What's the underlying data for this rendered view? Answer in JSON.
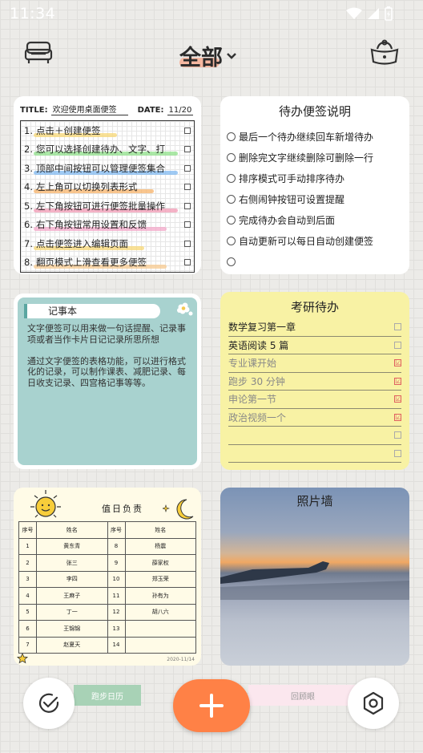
{
  "status_bar": {
    "time": "11:34"
  },
  "header": {
    "title": "全部",
    "left_icon": "sofa-icon",
    "right_icon": "chest-icon",
    "title_icon": "chevron-down-icon"
  },
  "card_welcome": {
    "title_label": "TITLE:",
    "title_value": "欢迎使用桌面便签",
    "date_label": "DATE:",
    "date_value": "11/20",
    "items": [
      {
        "num": "1.",
        "text": "点击＋创建便签",
        "highlight": "#f7d774"
      },
      {
        "num": "2.",
        "text": "您可以选择创建待办、文字、打",
        "highlight": "#8fe08a"
      },
      {
        "num": "3.",
        "text": "顶部中间按钮可以管理便签集合",
        "highlight": "#7fb8f0"
      },
      {
        "num": "4.",
        "text": "左上角可以切换列表形式",
        "highlight": "#f7b36a"
      },
      {
        "num": "5.",
        "text": "左下角按钮可进行便签批量操作",
        "highlight": "#f29ab4"
      },
      {
        "num": "6.",
        "text": "右下角按钮常用设置和反馈",
        "highlight": "#f3a7c8"
      },
      {
        "num": "7.",
        "text": "点击便签进入编辑页面",
        "highlight": "#f7d774"
      },
      {
        "num": "8.",
        "text": "翻页模式上滑查看更多便签",
        "highlight": "#f7c98f"
      }
    ]
  },
  "card_todo_help": {
    "title": "待办便签说明",
    "items": [
      "最后一个待办继续回车新增待办",
      "删除完文字继续删除可删除一行",
      "排序模式可手动排序待办",
      "右侧闹钟按钮可设置提醒",
      "完成待办会自动到后面",
      "自动更新可以每日自动创建便签",
      ""
    ]
  },
  "card_notebook": {
    "tab_label": "记事本",
    "text": "文字便签可以用来做一句话提醒、记录事项或者当作卡片日记记录所思所想\n\n通过文字便签的表格功能，可以进行格式化的记录，可以制作课表、减肥记录、每日收支记录、四宫格记事等等。"
  },
  "card_exam": {
    "title": "考研待办",
    "items": [
      {
        "text": "数学复习第一章",
        "done": false
      },
      {
        "text": "英语阅读 5 篇",
        "done": false
      },
      {
        "text": "专业课开始",
        "done": true
      },
      {
        "text": "跑步 30 分钟",
        "done": true
      },
      {
        "text": "申论第一节",
        "done": true
      },
      {
        "text": "政治视频一个",
        "done": true
      },
      {
        "text": "",
        "done": false
      },
      {
        "text": "",
        "done": false
      }
    ],
    "check_mark": "☑"
  },
  "card_duty": {
    "title": "值日负责",
    "headers": [
      "序号",
      "姓名",
      "序号",
      "姓名"
    ],
    "rows": [
      [
        "1",
        "黄东青",
        "8",
        "杨震"
      ],
      [
        "2",
        "张三",
        "9",
        "薛家权"
      ],
      [
        "3",
        "李四",
        "10",
        "郑玉荣"
      ],
      [
        "4",
        "王麻子",
        "11",
        "孙有为"
      ],
      [
        "5",
        "丁一",
        "12",
        "胡八六"
      ],
      [
        "6",
        "王锦锦",
        "13",
        ""
      ],
      [
        "7",
        "赵夏天",
        "14",
        ""
      ]
    ],
    "footer": "2020-11/14"
  },
  "card_photo": {
    "title": "照片墙"
  },
  "peek_cards": {
    "left": "跑步日历",
    "right": "回顾眼"
  },
  "bottom_bar": {
    "left_icon": "check-circle-icon",
    "add_icon": "plus-icon",
    "right_icon": "settings-icon"
  }
}
